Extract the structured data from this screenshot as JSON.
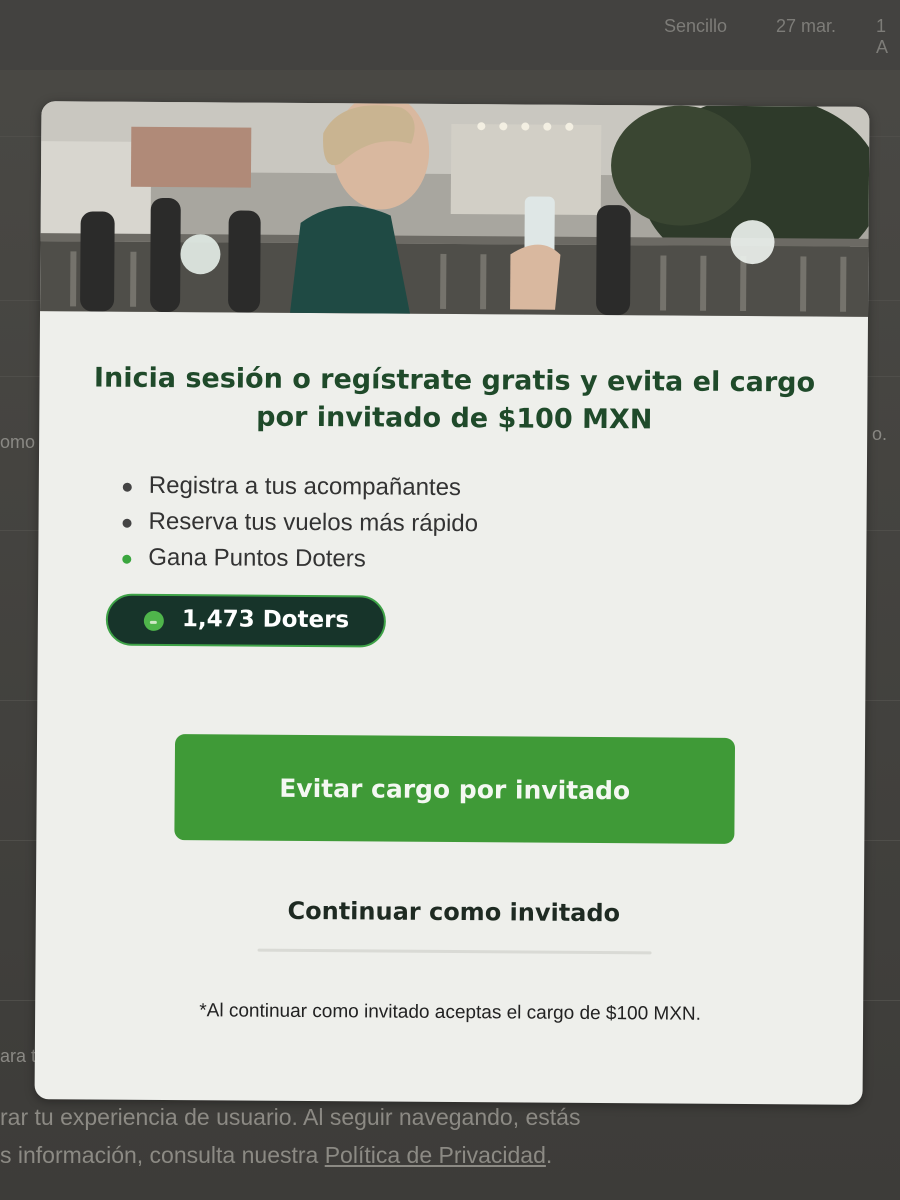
{
  "background_page": {
    "top_bar": {
      "trip_type": "Sencillo",
      "date": "27 mar.",
      "extra": "1 A"
    },
    "side_fragments": {
      "left_1": "omo",
      "right_1": "o.",
      "left_2": "ara tu"
    },
    "cookie_notice": {
      "line1": "rar tu experiencia de usuario. Al seguir navegando, estás",
      "line2_prefix": "s información, consulta nuestra ",
      "privacy_link": "Política de Privacidad",
      "line2_suffix": "."
    }
  },
  "modal": {
    "headline": "Inicia sesión o regístrate gratis y evita el cargo por invitado de $100 MXN",
    "benefits": [
      {
        "text": "Registra a tus acompañantes",
        "bullet": "#444444"
      },
      {
        "text": "Reserva tus vuelos más rápido",
        "bullet": "#444444"
      },
      {
        "text": "Gana Puntos Doters",
        "bullet": "#3aa63e"
      }
    ],
    "points_badge": "1,473 Doters",
    "primary_button": "Evitar cargo por invitado",
    "secondary_button": "Continuar como invitado",
    "disclaimer": "*Al continuar como invitado aceptas el cargo de $100 MXN."
  },
  "colors": {
    "brand_green": "#3f9a37",
    "headline_green": "#1f4a2a",
    "badge_bg": "#17342a"
  }
}
